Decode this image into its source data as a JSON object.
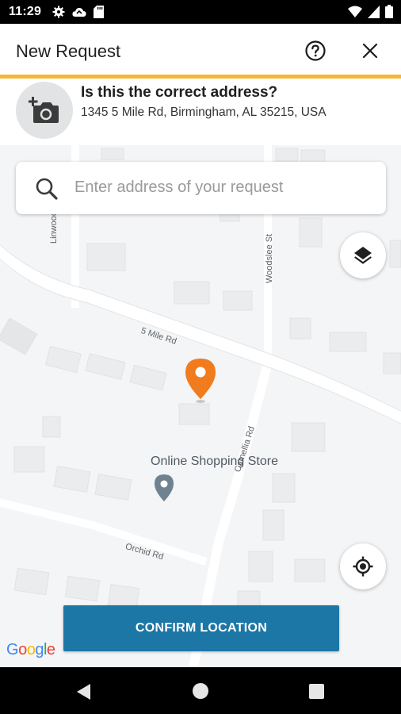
{
  "status_bar": {
    "time": "11:29",
    "left_icons": [
      "gear-icon",
      "cloud-sync-icon",
      "sd-card-icon"
    ],
    "right_icons": [
      "wifi-icon",
      "cellular-icon",
      "battery-icon"
    ]
  },
  "header": {
    "title": "New Request",
    "help_icon": "help-circle-icon",
    "close_icon": "close-icon",
    "accent_color": "#f5b731"
  },
  "address_panel": {
    "photo_icon": "add-photo-icon",
    "question": "Is this the correct address?",
    "address": "1345 5 Mile Rd, Birmingham, AL 35215, USA"
  },
  "map": {
    "search": {
      "placeholder": "Enter address of your request",
      "value": ""
    },
    "street_labels": {
      "linwood": "Linwood St",
      "woodslee": "Woodslee St",
      "five_mile": "5 Mile Rd",
      "camellia": "Camellia Rd",
      "orchid": "Orchid Rd"
    },
    "poi_label": "Online Shopping Store",
    "pin_color": "#f07c1e",
    "poi_pin_color": "#6f8290",
    "layers_icon": "layers-icon",
    "locate_icon": "my-location-icon",
    "confirm_label": "CONFIRM LOCATION",
    "confirm_color": "#1d77a6",
    "attribution": {
      "letters": [
        "G",
        "o",
        "o",
        "g",
        "l",
        "e"
      ],
      "colors": [
        "#4285f4",
        "#ea4335",
        "#fbbc05",
        "#4285f4",
        "#34a853",
        "#ea4335"
      ]
    }
  },
  "nav_bar": {
    "icons": [
      "back-icon",
      "home-icon",
      "recents-icon"
    ]
  }
}
